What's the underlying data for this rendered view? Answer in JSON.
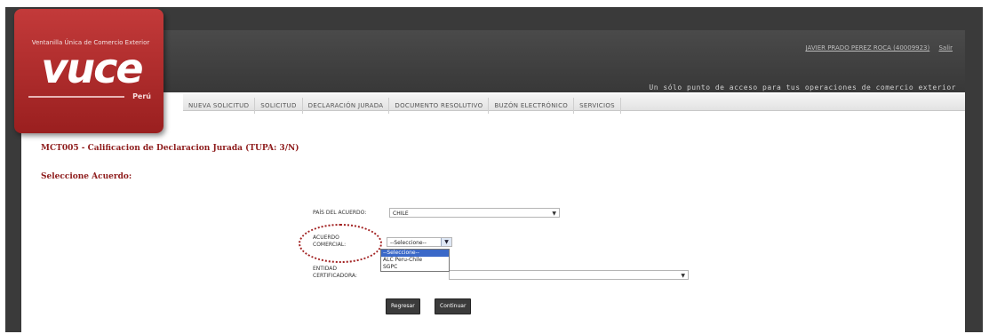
{
  "logo": {
    "tagline": "Ventanilla Única de Comercio Exterior",
    "word": "vuce",
    "country": "Perú"
  },
  "header": {
    "user_name": "JAVIER PRADO PEREZ ROCA (40009923)",
    "logout": "Salir",
    "slogan": "Un sólo punto de acceso para tus operaciones de comercio exterior"
  },
  "nav": {
    "items": [
      {
        "label": "NUEVA SOLICITUD"
      },
      {
        "label": "SOLICITUD"
      },
      {
        "label": "DECLARACIÓN JURADA"
      },
      {
        "label": "DOCUMENTO RESOLUTIVO"
      },
      {
        "label": "BUZÓN ELECTRÓNICO"
      },
      {
        "label": "SERVICIOS"
      }
    ]
  },
  "main": {
    "page_title": "MCT005 - Calificacion de Declaracion Jurada (TUPA: 3/N)",
    "section_title": "Seleccione Acuerdo:"
  },
  "form": {
    "pais_label": "PAÍS DEL ACUERDO:",
    "pais_value": "CHILE",
    "acuerdo_label_1": "ACUERDO",
    "acuerdo_label_2": "COMERCIAL:",
    "acuerdo_value": "--Seleccione--",
    "acuerdo_options": [
      "--Seleccione--",
      "ALC Peru-Chile",
      "SGPC"
    ],
    "entidad_label_1": "ENTIDAD",
    "entidad_label_2": "CERTIFICADORA:"
  },
  "buttons": {
    "regresar": "Regresar",
    "continuar": "Continuar"
  },
  "colors": {
    "brand_red": "#9a1f1f",
    "header_dark": "#3a3a3a",
    "title_red": "#8e1c1c",
    "selection_blue": "#3a68c8"
  }
}
